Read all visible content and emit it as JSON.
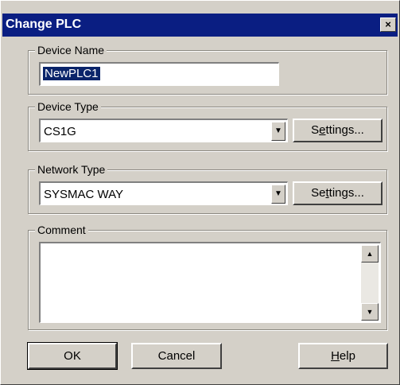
{
  "window": {
    "title": "Change PLC",
    "close_glyph": "×"
  },
  "device_name": {
    "legend": "Device Name",
    "value": "NewPLC1"
  },
  "device_type": {
    "legend": "Device Type",
    "value": "CS1G",
    "settings_pre": "S",
    "settings_mnemonic": "e",
    "settings_post": "ttings..."
  },
  "network_type": {
    "legend": "Network Type",
    "value": "SYSMAC WAY",
    "settings_pre": "Se",
    "settings_mnemonic": "t",
    "settings_post": "tings..."
  },
  "comment": {
    "legend": "Comment",
    "value": "",
    "scroll_up_glyph": "▲",
    "scroll_down_glyph": "▼"
  },
  "buttons": {
    "ok": "OK",
    "cancel": "Cancel",
    "help_mnemonic": "H",
    "help_post": "elp"
  },
  "icons": {
    "combo_arrow": "▼"
  }
}
